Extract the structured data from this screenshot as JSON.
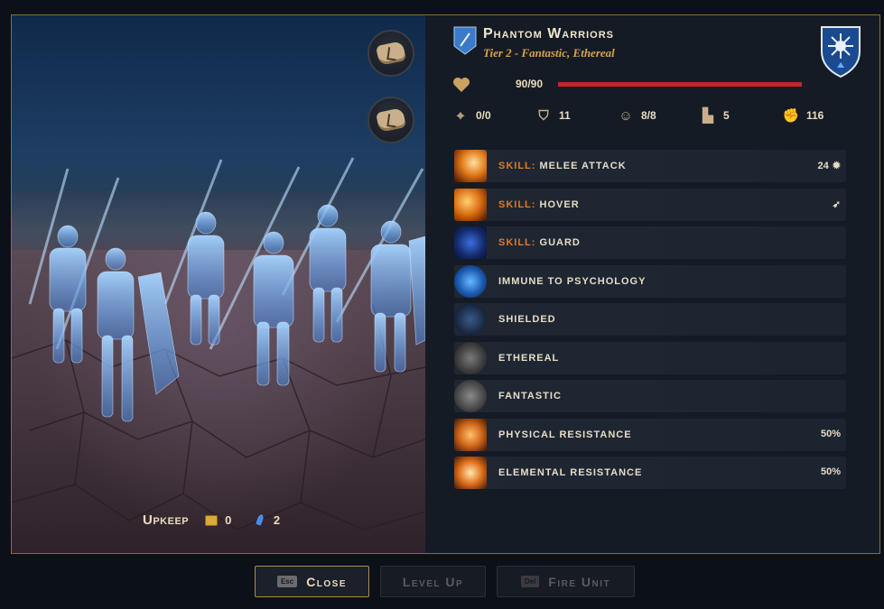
{
  "unit": {
    "name": "Phantom Warriors",
    "tier_line": "Tier 2 - Fantastic, Ethereal",
    "hp_text": "90/90",
    "hp_fraction": 1.0
  },
  "stats": [
    {
      "icon": "crosshair-icon",
      "value": "0/0"
    },
    {
      "icon": "defense-shield-icon",
      "value": "11"
    },
    {
      "icon": "morale-icon",
      "value": "8/8"
    },
    {
      "icon": "boot-movement-icon",
      "value": "5"
    },
    {
      "icon": "fist-strength-icon",
      "value": "116"
    }
  ],
  "abilities": [
    {
      "prefix": "Skill:",
      "label": "Melee Attack",
      "value": "24",
      "value_icon": "sun-burst-icon",
      "icon": "melee-attack-icon"
    },
    {
      "prefix": "Skill:",
      "label": "Hover",
      "value": "",
      "value_icon": "cursor-feather-icon",
      "icon": "hover-icon"
    },
    {
      "prefix": "Skill:",
      "label": "Guard",
      "value": "",
      "value_icon": "",
      "icon": "guard-icon"
    },
    {
      "prefix": "",
      "label": "Immune to Psychology",
      "value": "",
      "value_icon": "",
      "icon": "brain-icon"
    },
    {
      "prefix": "",
      "label": "Shielded",
      "value": "",
      "value_icon": "",
      "icon": "shield-icon"
    },
    {
      "prefix": "",
      "label": "Ethereal",
      "value": "",
      "value_icon": "",
      "icon": "knot-icon"
    },
    {
      "prefix": "",
      "label": "Fantastic",
      "value": "",
      "value_icon": "",
      "icon": "griffon-icon"
    },
    {
      "prefix": "",
      "label": "Physical Resistance",
      "value": "50%",
      "value_icon": "",
      "icon": "sword-slash-icon"
    },
    {
      "prefix": "",
      "label": "Elemental Resistance",
      "value": "50%",
      "value_icon": "",
      "icon": "fireball-icon"
    }
  ],
  "upkeep": {
    "label": "Upkeep",
    "gold": "0",
    "mana": "2"
  },
  "buttons": {
    "close": {
      "key": "Esc",
      "label": "Close"
    },
    "level_up": {
      "label": "Level Up"
    },
    "fire_unit": {
      "key": "Del",
      "label": "Fire Unit"
    }
  },
  "colors": {
    "accent_gold": "#d9a24a",
    "skill_orange": "#e07a28",
    "hp_red": "#c0252a",
    "panel_bg": "#151b25"
  }
}
